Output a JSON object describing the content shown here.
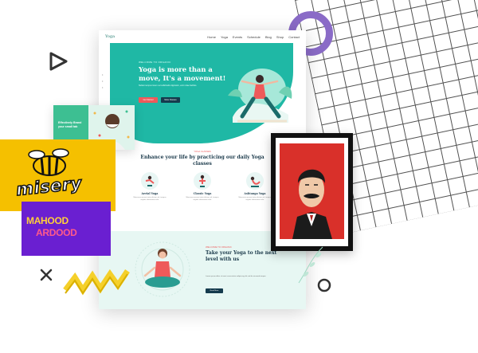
{
  "colors": {
    "teal": "#1fb8a5",
    "coral": "#ee5a5a",
    "navy": "#153b4d",
    "yellow": "#f5c000",
    "purple": "#6a1fd1",
    "red": "#d9302a",
    "lavender": "#8a6bc7"
  },
  "mockup": {
    "nav": {
      "logo": "Yoga",
      "links": [
        "Home",
        "Yoga",
        "Events",
        "Schedule",
        "Blog",
        "Shop",
        "Contact"
      ]
    },
    "hero": {
      "tag": "WELCOME TO ORGANIC",
      "title": "Yoga is more than a move, It's a movement!",
      "subtitle": "Nullam tempus lorem vel sollicitudin dignissim, enim vitae facilisis.",
      "primary_button": "Get Started",
      "secondary_button": "More Classes"
    },
    "classes": {
      "tag": "YOGA CLASSES",
      "title": "Enhance your life by practicing our daily Yoga classes",
      "cards": [
        {
          "title": "Aerial Yoga",
          "text": "Maecenas ipsum tortor dictum vel, tempus sagittis elementum velit."
        },
        {
          "title": "Classic Yoga",
          "text": "Maecenas ipsum tortor dictum vel, tempus sagittis elementum velit."
        },
        {
          "title": "Ashtanga Yoga",
          "text": "Maecenas ipsum tortor dictum vel, tempus sagittis elementum velit."
        }
      ]
    },
    "level": {
      "tag": "WELCOME TO ORGANIC",
      "title": "Take your Yoga to the next level with us",
      "text": "Lorem ipsum dolor sit amet consectetur adipiscing elit sed do eiusmod tempor.",
      "button": "Read More"
    }
  },
  "cards": {
    "green_text": "Effectively Brand your small tab",
    "misery": "misery",
    "purple_line1": "MAHOOD",
    "purple_line2": "ARDOOD"
  },
  "icons": [
    "triangle-outline-icon",
    "cross-icon",
    "circle-outline-icon",
    "ring-icon",
    "zigzag-icon"
  ]
}
